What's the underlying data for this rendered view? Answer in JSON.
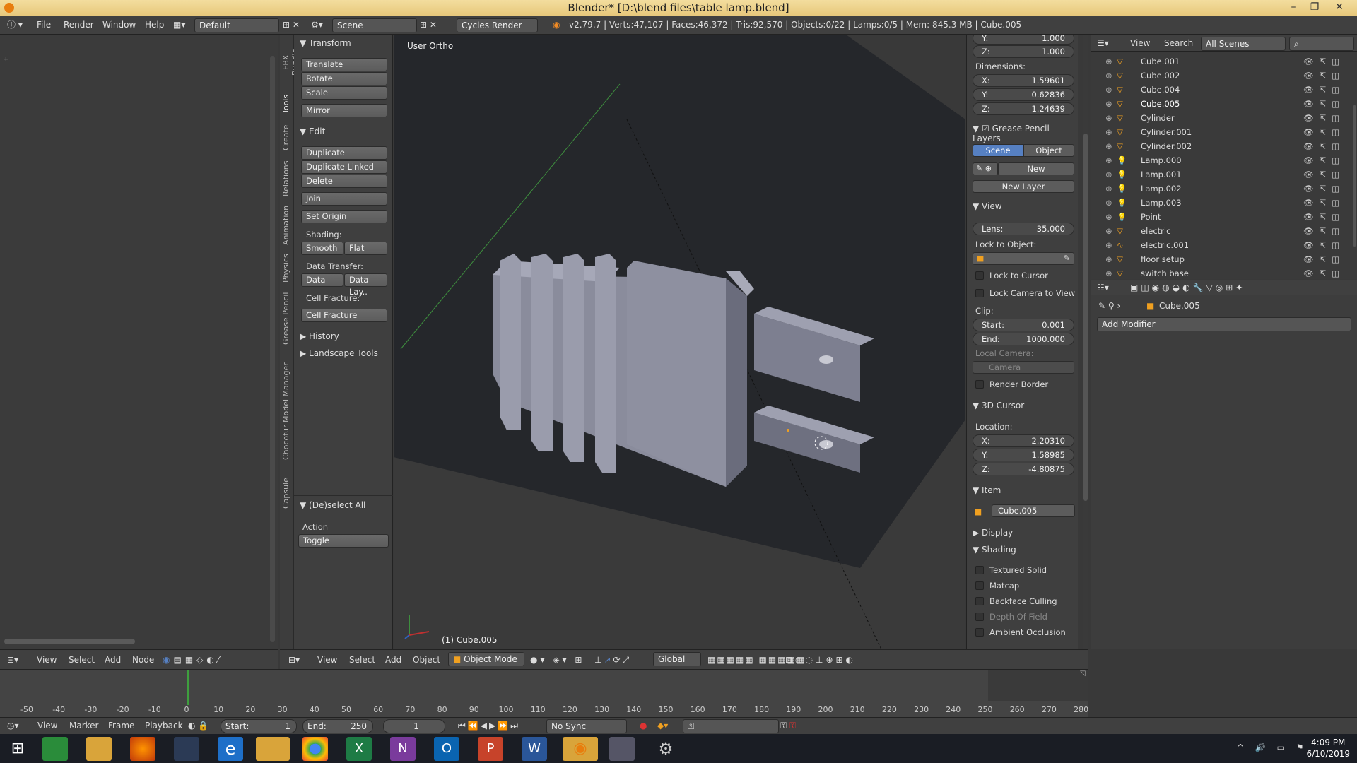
{
  "window": {
    "title": "Blender* [D:\\blend files\\table lamp.blend]"
  },
  "infobar": {
    "menus": [
      "File",
      "Render",
      "Window",
      "Help"
    ],
    "screen_layout": "Default",
    "scene": "Scene",
    "render_engine": "Cycles Render",
    "stats": "v2.79.7 | Verts:47,107 | Faces:46,372 | Tris:92,570 | Objects:0/22 | Lamps:0/5 | Mem: 845.3 MB | Cube.005"
  },
  "vertical_tabs": [
    "FBX Bundle",
    "Tools",
    "Create",
    "Relations",
    "Animation",
    "Physics",
    "Grease Pencil",
    "Chocofur Model Manager",
    "Capsule"
  ],
  "toolshelf": {
    "transform_header": "Transform",
    "translate": "Translate",
    "rotate": "Rotate",
    "scale": "Scale",
    "mirror": "Mirror",
    "edit_header": "Edit",
    "duplicate": "Duplicate",
    "duplicate_linked": "Duplicate Linked",
    "delete": "Delete",
    "join": "Join",
    "set_origin": "Set Origin",
    "shading_label": "Shading:",
    "smooth": "Smooth",
    "flat": "Flat",
    "data_transfer_label": "Data Transfer:",
    "data": "Data",
    "data_layers": "Data Lay..",
    "cell_fracture_label": "Cell Fracture:",
    "cell_fracture": "Cell Fracture",
    "history": "History",
    "landscape_tools": "Landscape Tools",
    "deselect_header": "(De)select All",
    "action_label": "Action",
    "action_value": "Toggle"
  },
  "viewport": {
    "view_label": "User Ortho",
    "object_label": "(1) Cube.005"
  },
  "npanel": {
    "scale_y_key": "Y:",
    "scale_y": "1.000",
    "scale_z_key": "Z:",
    "scale_z": "1.000",
    "dimensions_label": "Dimensions:",
    "dim_x": "1.59601",
    "dim_y": "0.62836",
    "dim_z": "1.24639",
    "x_key": "X:",
    "y_key": "Y:",
    "z_key": "Z:",
    "gp_layers": "Grease Pencil Layers",
    "scene_btn": "Scene",
    "object_btn": "Object",
    "new_btn": "New",
    "new_layer": "New Layer",
    "view_header": "View",
    "lens_key": "Lens:",
    "lens": "35.000",
    "lock_to_object": "Lock to Object:",
    "lock_to_cursor": "Lock to Cursor",
    "lock_camera": "Lock Camera to View",
    "clip_label": "Clip:",
    "start_key": "Start:",
    "clip_start": "0.001",
    "end_key": "End:",
    "clip_end": "1000.000",
    "local_camera": "Local Camera:",
    "camera": "Camera",
    "render_border": "Render Border",
    "cursor_header": "3D Cursor",
    "location_label": "Location:",
    "cur_x": "2.20310",
    "cur_y": "1.58985",
    "cur_z": "-4.80875",
    "item_header": "Item",
    "item_name": "Cube.005",
    "display_header": "Display",
    "shading_header": "Shading",
    "textured_solid": "Textured Solid",
    "matcap": "Matcap",
    "backface": "Backface Culling",
    "dof": "Depth Of Field",
    "ao": "Ambient Occlusion"
  },
  "outliner": {
    "view": "View",
    "search": "Search",
    "scenes": "All Scenes",
    "items": [
      {
        "name": "Cube.001",
        "type": "mesh"
      },
      {
        "name": "Cube.002",
        "type": "mesh"
      },
      {
        "name": "Cube.004",
        "type": "mesh"
      },
      {
        "name": "Cube.005",
        "type": "mesh"
      },
      {
        "name": "Cylinder",
        "type": "mesh"
      },
      {
        "name": "Cylinder.001",
        "type": "mesh"
      },
      {
        "name": "Cylinder.002",
        "type": "mesh"
      },
      {
        "name": "Lamp.000",
        "type": "lamp"
      },
      {
        "name": "Lamp.001",
        "type": "lamp"
      },
      {
        "name": "Lamp.002",
        "type": "lamp"
      },
      {
        "name": "Lamp.003",
        "type": "lamp"
      },
      {
        "name": "Point",
        "type": "lamp"
      },
      {
        "name": "electric",
        "type": "mesh"
      },
      {
        "name": "electric.001",
        "type": "curve"
      },
      {
        "name": "floor setup",
        "type": "mesh"
      },
      {
        "name": "switch base",
        "type": "mesh"
      }
    ]
  },
  "properties": {
    "object_name": "Cube.005",
    "add_modifier": "Add Modifier"
  },
  "viewport_header": {
    "view": "View",
    "select": "Select",
    "add": "Add",
    "object": "Object",
    "mode": "Object Mode",
    "orientation": "Global"
  },
  "node_header": {
    "view": "View",
    "select": "Select",
    "add": "Add",
    "node": "Node"
  },
  "timeline": {
    "ticks": [
      "-50",
      "-40",
      "-30",
      "-20",
      "-10",
      "0",
      "10",
      "20",
      "30",
      "40",
      "50",
      "60",
      "70",
      "80",
      "90",
      "100",
      "110",
      "120",
      "130",
      "140",
      "150",
      "160",
      "170",
      "180",
      "190",
      "200",
      "210",
      "220",
      "230",
      "240",
      "250",
      "260",
      "270",
      "280"
    ],
    "view": "View",
    "marker": "Marker",
    "frame": "Frame",
    "playback": "Playback",
    "start_label": "Start:",
    "start": "1",
    "end_label": "End:",
    "end": "250",
    "current": "1",
    "sync": "No Sync"
  },
  "taskbar": {
    "time": "4:09 PM",
    "date": "6/10/2019"
  },
  "colors": {
    "accent": "#5680c2",
    "orange": "#f08a24",
    "header": "#404040",
    "panel": "#3f3f3f",
    "grid_green": "#3e8e3e"
  }
}
